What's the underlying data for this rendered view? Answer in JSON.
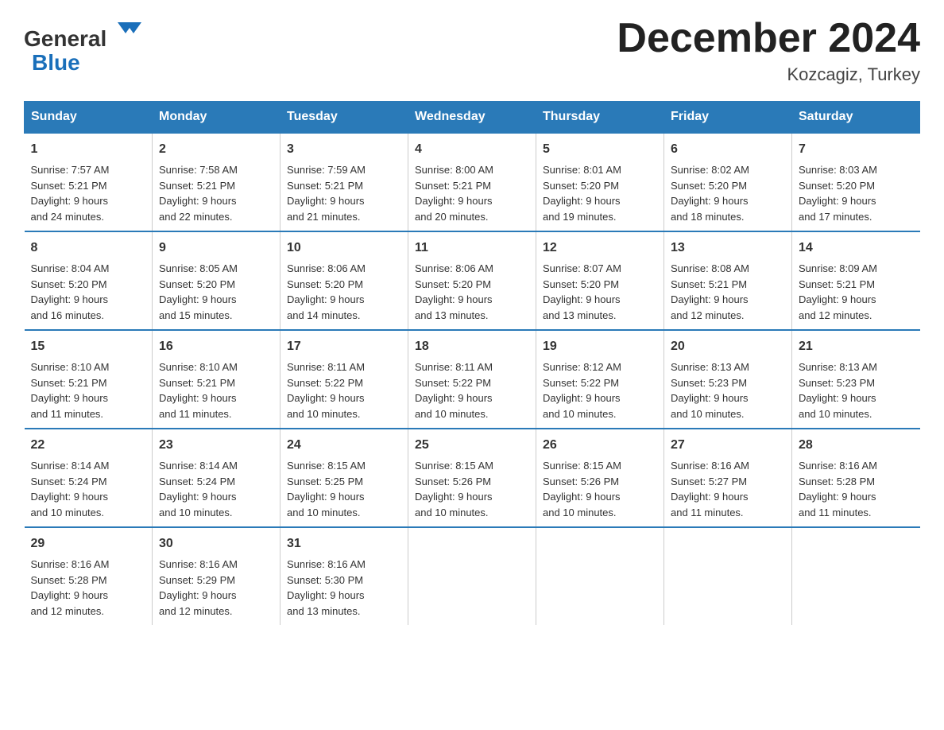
{
  "header": {
    "logo_general": "General",
    "logo_blue": "Blue",
    "title": "December 2024",
    "subtitle": "Kozcagiz, Turkey"
  },
  "days_of_week": [
    "Sunday",
    "Monday",
    "Tuesday",
    "Wednesday",
    "Thursday",
    "Friday",
    "Saturday"
  ],
  "weeks": [
    [
      {
        "day": "1",
        "sunrise": "7:57 AM",
        "sunset": "5:21 PM",
        "daylight": "9 hours and 24 minutes."
      },
      {
        "day": "2",
        "sunrise": "7:58 AM",
        "sunset": "5:21 PM",
        "daylight": "9 hours and 22 minutes."
      },
      {
        "day": "3",
        "sunrise": "7:59 AM",
        "sunset": "5:21 PM",
        "daylight": "9 hours and 21 minutes."
      },
      {
        "day": "4",
        "sunrise": "8:00 AM",
        "sunset": "5:21 PM",
        "daylight": "9 hours and 20 minutes."
      },
      {
        "day": "5",
        "sunrise": "8:01 AM",
        "sunset": "5:20 PM",
        "daylight": "9 hours and 19 minutes."
      },
      {
        "day": "6",
        "sunrise": "8:02 AM",
        "sunset": "5:20 PM",
        "daylight": "9 hours and 18 minutes."
      },
      {
        "day": "7",
        "sunrise": "8:03 AM",
        "sunset": "5:20 PM",
        "daylight": "9 hours and 17 minutes."
      }
    ],
    [
      {
        "day": "8",
        "sunrise": "8:04 AM",
        "sunset": "5:20 PM",
        "daylight": "9 hours and 16 minutes."
      },
      {
        "day": "9",
        "sunrise": "8:05 AM",
        "sunset": "5:20 PM",
        "daylight": "9 hours and 15 minutes."
      },
      {
        "day": "10",
        "sunrise": "8:06 AM",
        "sunset": "5:20 PM",
        "daylight": "9 hours and 14 minutes."
      },
      {
        "day": "11",
        "sunrise": "8:06 AM",
        "sunset": "5:20 PM",
        "daylight": "9 hours and 13 minutes."
      },
      {
        "day": "12",
        "sunrise": "8:07 AM",
        "sunset": "5:20 PM",
        "daylight": "9 hours and 13 minutes."
      },
      {
        "day": "13",
        "sunrise": "8:08 AM",
        "sunset": "5:21 PM",
        "daylight": "9 hours and 12 minutes."
      },
      {
        "day": "14",
        "sunrise": "8:09 AM",
        "sunset": "5:21 PM",
        "daylight": "9 hours and 12 minutes."
      }
    ],
    [
      {
        "day": "15",
        "sunrise": "8:10 AM",
        "sunset": "5:21 PM",
        "daylight": "9 hours and 11 minutes."
      },
      {
        "day": "16",
        "sunrise": "8:10 AM",
        "sunset": "5:21 PM",
        "daylight": "9 hours and 11 minutes."
      },
      {
        "day": "17",
        "sunrise": "8:11 AM",
        "sunset": "5:22 PM",
        "daylight": "9 hours and 10 minutes."
      },
      {
        "day": "18",
        "sunrise": "8:11 AM",
        "sunset": "5:22 PM",
        "daylight": "9 hours and 10 minutes."
      },
      {
        "day": "19",
        "sunrise": "8:12 AM",
        "sunset": "5:22 PM",
        "daylight": "9 hours and 10 minutes."
      },
      {
        "day": "20",
        "sunrise": "8:13 AM",
        "sunset": "5:23 PM",
        "daylight": "9 hours and 10 minutes."
      },
      {
        "day": "21",
        "sunrise": "8:13 AM",
        "sunset": "5:23 PM",
        "daylight": "9 hours and 10 minutes."
      }
    ],
    [
      {
        "day": "22",
        "sunrise": "8:14 AM",
        "sunset": "5:24 PM",
        "daylight": "9 hours and 10 minutes."
      },
      {
        "day": "23",
        "sunrise": "8:14 AM",
        "sunset": "5:24 PM",
        "daylight": "9 hours and 10 minutes."
      },
      {
        "day": "24",
        "sunrise": "8:15 AM",
        "sunset": "5:25 PM",
        "daylight": "9 hours and 10 minutes."
      },
      {
        "day": "25",
        "sunrise": "8:15 AM",
        "sunset": "5:26 PM",
        "daylight": "9 hours and 10 minutes."
      },
      {
        "day": "26",
        "sunrise": "8:15 AM",
        "sunset": "5:26 PM",
        "daylight": "9 hours and 10 minutes."
      },
      {
        "day": "27",
        "sunrise": "8:16 AM",
        "sunset": "5:27 PM",
        "daylight": "9 hours and 11 minutes."
      },
      {
        "day": "28",
        "sunrise": "8:16 AM",
        "sunset": "5:28 PM",
        "daylight": "9 hours and 11 minutes."
      }
    ],
    [
      {
        "day": "29",
        "sunrise": "8:16 AM",
        "sunset": "5:28 PM",
        "daylight": "9 hours and 12 minutes."
      },
      {
        "day": "30",
        "sunrise": "8:16 AM",
        "sunset": "5:29 PM",
        "daylight": "9 hours and 12 minutes."
      },
      {
        "day": "31",
        "sunrise": "8:16 AM",
        "sunset": "5:30 PM",
        "daylight": "9 hours and 13 minutes."
      },
      null,
      null,
      null,
      null
    ]
  ],
  "labels": {
    "sunrise": "Sunrise:",
    "sunset": "Sunset:",
    "daylight": "Daylight:"
  }
}
